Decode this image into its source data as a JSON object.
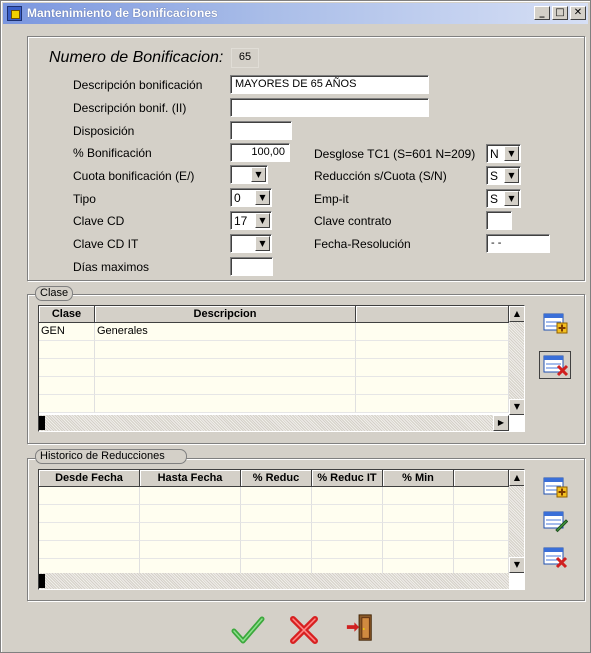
{
  "window": {
    "title": "Mantenimiento de Bonificaciones",
    "controls": {
      "minimize": "_",
      "maximize": "□",
      "close": "✕"
    }
  },
  "form": {
    "numero": {
      "label": "Numero de Bonificacion:",
      "value": "65"
    },
    "descripcion": {
      "label": "Descripción  bonificación",
      "value": "MAYORES DE 65 AÑOS"
    },
    "descripcion2": {
      "label": "Descripción bonif. (II)",
      "value": ""
    },
    "disposicion": {
      "label": "Disposición",
      "value": ""
    },
    "porcentaje": {
      "label": "% Bonificación",
      "value": "100,00"
    },
    "cuota": {
      "label": "Cuota bonificación (E/)",
      "value": ""
    },
    "tipo": {
      "label": "Tipo",
      "value": "0"
    },
    "clave_cd": {
      "label": "Clave CD",
      "value": "17"
    },
    "clave_cd_it": {
      "label": "Clave CD IT",
      "value": ""
    },
    "dias_maximos": {
      "label": "Días maximos",
      "value": ""
    },
    "desglose": {
      "label": "Desglose  TC1 (S=601 N=209)",
      "value": "N"
    },
    "reduccion_cuota": {
      "label": "Reducción s/Cuota (S/N)",
      "value": "S"
    },
    "emp_it": {
      "label": "Emp-it",
      "value": "S"
    },
    "clave_contrato": {
      "label": "Clave contrato",
      "value": ""
    },
    "fecha_resolucion": {
      "label": "Fecha-Resolución",
      "value": "- -"
    }
  },
  "clase": {
    "group_label": "Clase",
    "columns": [
      "Clase",
      "Descripcion",
      ""
    ],
    "rows": [
      [
        "GEN",
        "Generales",
        ""
      ]
    ],
    "icons": [
      "add-row-icon",
      "delete-row-icon"
    ]
  },
  "historico": {
    "group_label": "Historico de Reducciones",
    "columns": [
      "Desde Fecha",
      "Hasta Fecha",
      "% Reduc",
      "% Reduc IT",
      "% Min",
      ""
    ],
    "icons": [
      "add-row-icon",
      "edit-row-icon",
      "delete-row-icon"
    ]
  },
  "actions": {
    "icons": [
      "accept-check-icon",
      "cancel-x-icon",
      "exit-door-icon"
    ]
  },
  "colors": {
    "window_bg": "#d4d0c8",
    "title_gradient_start": "#7a96df",
    "grid_row_bg": "#fffef0",
    "accept": "#3ca83c",
    "cancel": "#d82020"
  }
}
